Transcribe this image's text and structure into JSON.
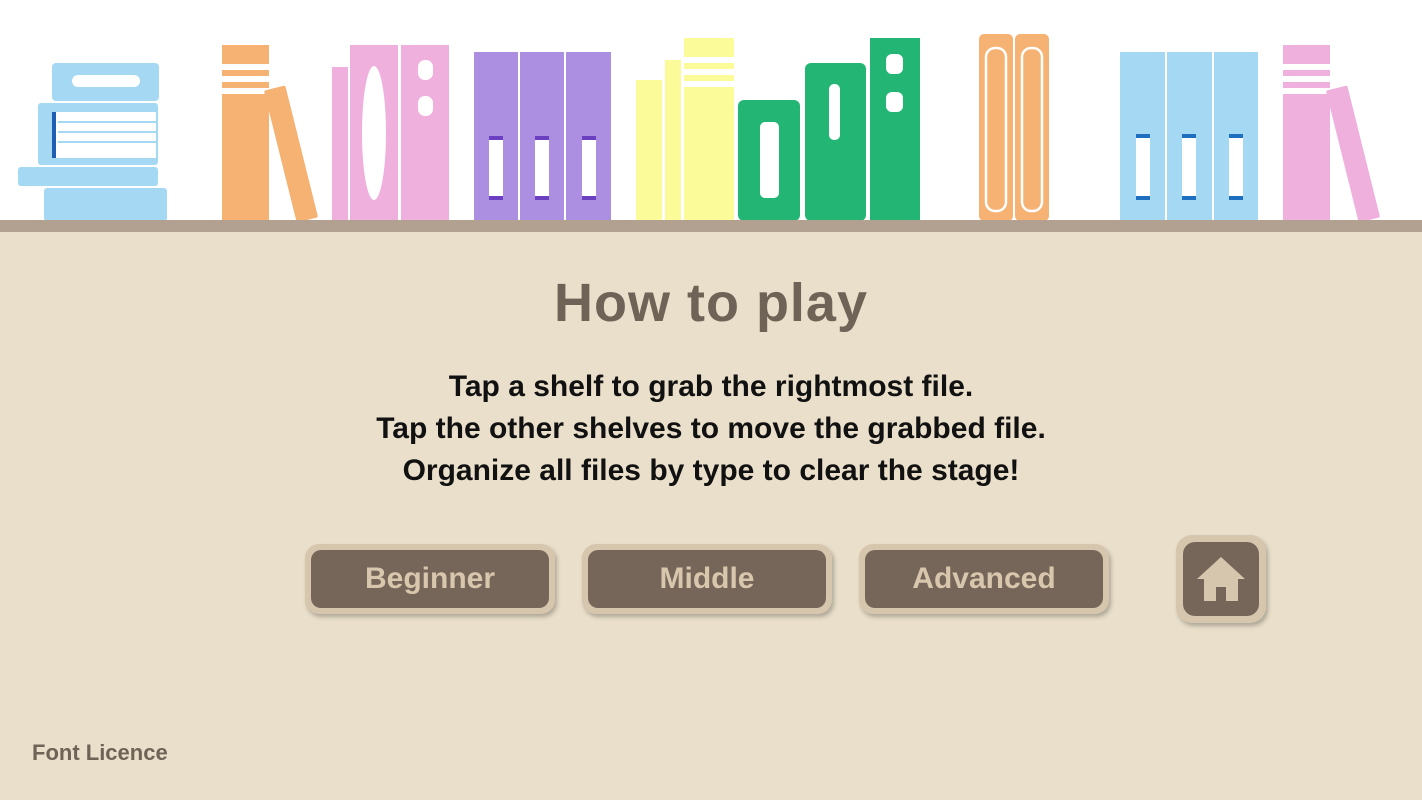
{
  "title": "How to play",
  "instructions": [
    "Tap a shelf to grab the rightmost file.",
    "Tap the other shelves to move the grabbed file.",
    "Organize all files by type to clear the stage!"
  ],
  "buttons": {
    "beginner": "Beginner",
    "middle": "Middle",
    "advanced": "Advanced"
  },
  "home_icon": "home-icon",
  "footer": {
    "font_licence": "Font Licence"
  },
  "colors": {
    "background": "#e9dfca",
    "shelf": "#b2a091",
    "title": "#6f6357",
    "button_face": "#766659",
    "button_border": "#d7c6ae",
    "button_text": "#d8c7ad",
    "books": {
      "blue": "#a5d8f3",
      "orange": "#f6b273",
      "pink": "#efb0de",
      "purple": "#ac8fe0",
      "yellow": "#fbfb9a",
      "green": "#22b573"
    }
  }
}
